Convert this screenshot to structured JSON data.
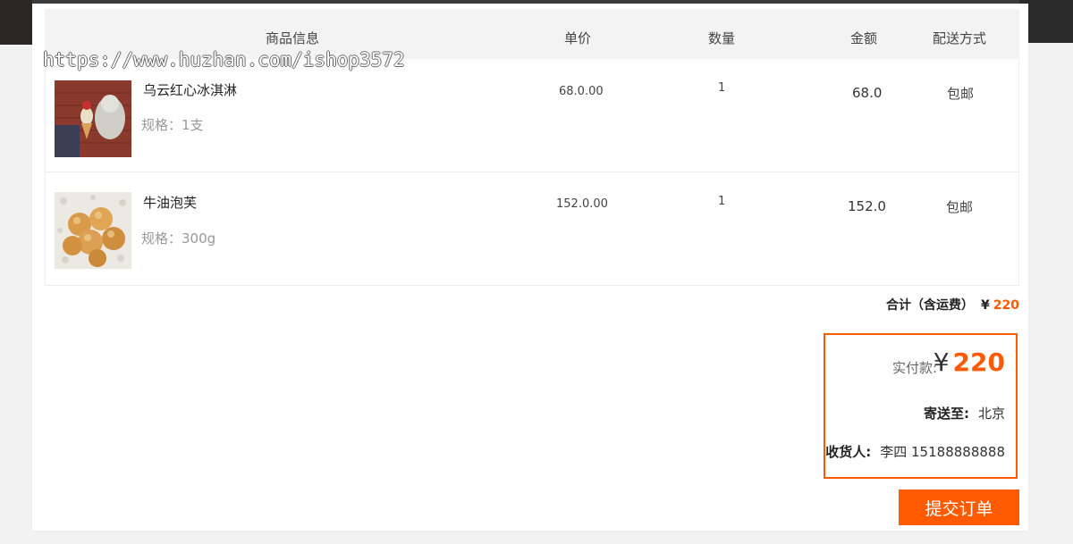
{
  "watermark": "https://www.huzhan.com/ishop3572",
  "table": {
    "headers": {
      "product": "商品信息",
      "unit_price": "单价",
      "quantity": "数量",
      "amount": "金额",
      "delivery": "配送方式"
    },
    "rows": [
      {
        "name": "乌云红心冰淇淋",
        "spec": "规格：1支",
        "unit_price": "68.0.00",
        "quantity": "1",
        "amount": "68.0",
        "delivery": "包邮"
      },
      {
        "name": "牛油泡芙",
        "spec": "规格：300g",
        "unit_price": "152.0.00",
        "quantity": "1",
        "amount": "152.0",
        "delivery": "包邮"
      }
    ]
  },
  "summary": {
    "total_label": "合计（含运费）",
    "currency": "¥",
    "total_value": "220"
  },
  "payment": {
    "label": "实付款:",
    "currency": "¥",
    "amount": "220",
    "ship_to_label": "寄送至:",
    "ship_to_value": "北京",
    "receiver_label": "收货人:",
    "receiver_value": "李四 15188888888"
  },
  "submit_label": "提交订单",
  "colors": {
    "accent": "#ff5a00",
    "header_bg": "#f3f3f3"
  }
}
